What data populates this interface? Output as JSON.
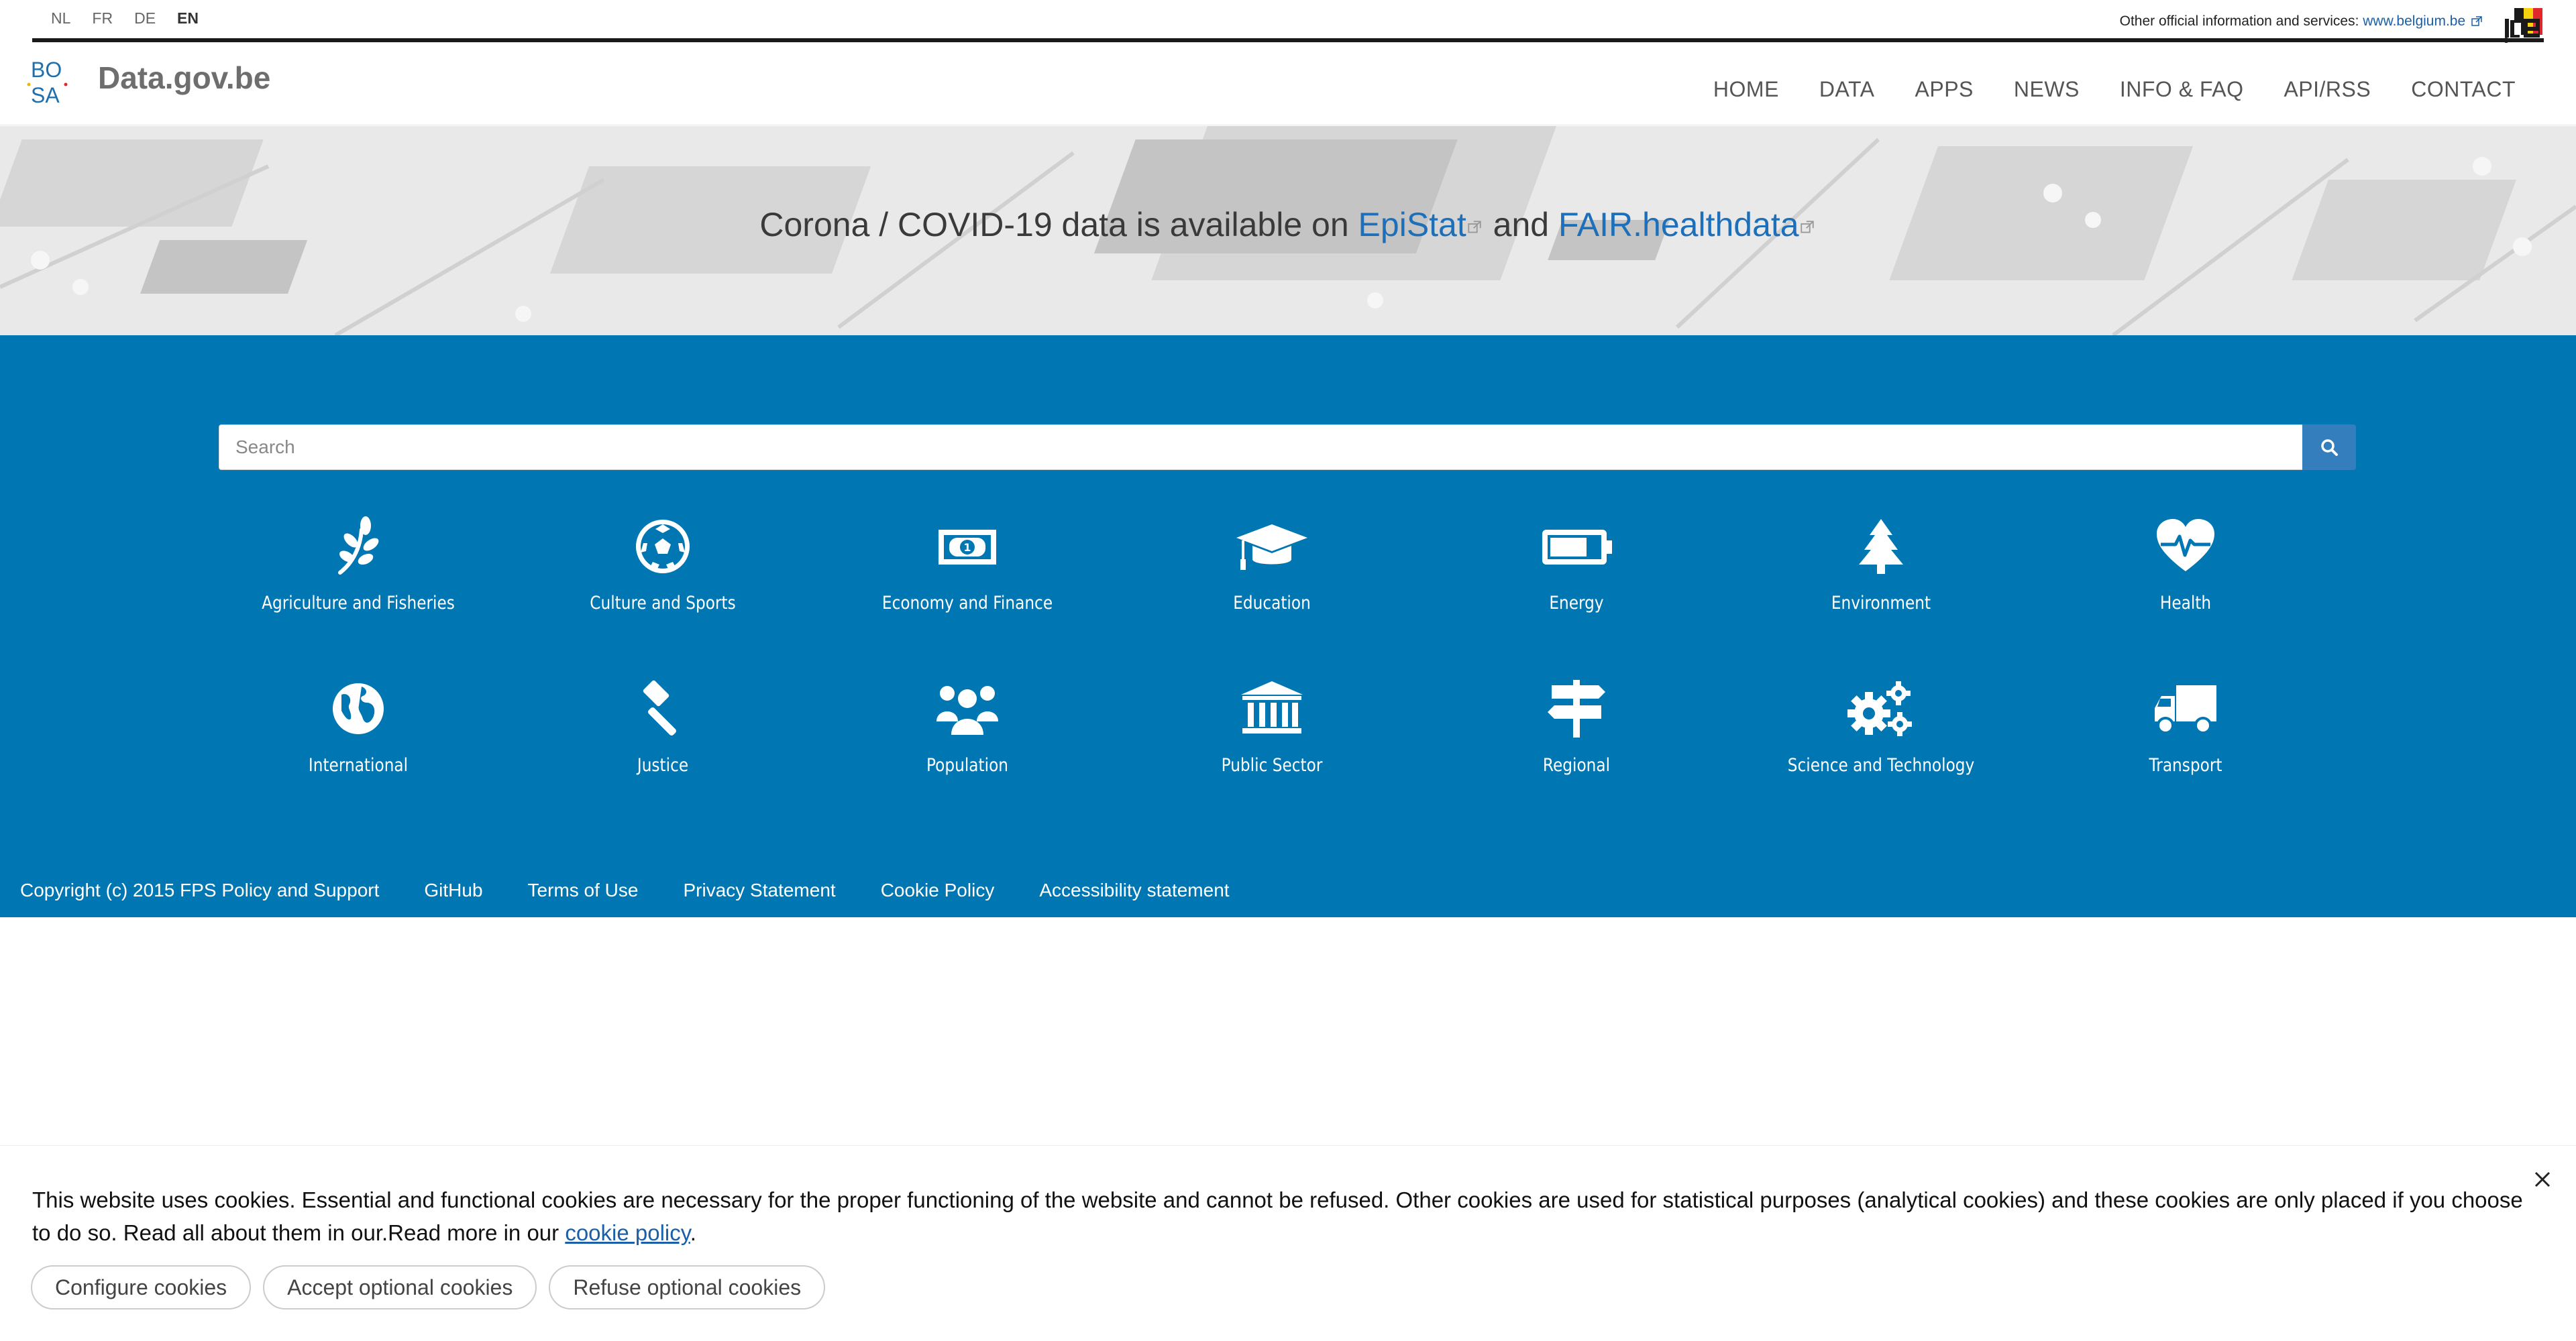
{
  "languages": {
    "nl": "NL",
    "fr": "FR",
    "de": "DE",
    "en": "EN",
    "active": "EN"
  },
  "official": {
    "text": "Other official information and services:",
    "link": "www.belgium.be"
  },
  "header": {
    "site_title": "Data.gov.be",
    "logo_text": [
      "BO",
      "SA"
    ],
    "nav": [
      "HOME",
      "DATA",
      "APPS",
      "NEWS",
      "INFO & FAQ",
      "API/RSS",
      "CONTACT"
    ]
  },
  "hero": {
    "prefix": "Corona / COVID-19 data is available on",
    "link1": "EpiStat",
    "middle": "and",
    "link2": "FAIR.healthdata"
  },
  "search": {
    "placeholder": "Search",
    "button_icon": "search-icon"
  },
  "categories": [
    {
      "label": "Agriculture and Fisheries",
      "icon": "leaf-icon"
    },
    {
      "label": "Culture and Sports",
      "icon": "soccer-ball-icon"
    },
    {
      "label": "Economy and Finance",
      "icon": "banknote-icon"
    },
    {
      "label": "Education",
      "icon": "graduation-cap-icon"
    },
    {
      "label": "Energy",
      "icon": "battery-icon"
    },
    {
      "label": "Environment",
      "icon": "tree-icon"
    },
    {
      "label": "Health",
      "icon": "heartbeat-icon"
    },
    {
      "label": "International",
      "icon": "globe-icon"
    },
    {
      "label": "Justice",
      "icon": "gavel-icon"
    },
    {
      "label": "Population",
      "icon": "people-icon"
    },
    {
      "label": "Public Sector",
      "icon": "institution-icon"
    },
    {
      "label": "Regional",
      "icon": "signpost-icon"
    },
    {
      "label": "Science and Technology",
      "icon": "gears-icon"
    },
    {
      "label": "Transport",
      "icon": "truck-icon"
    }
  ],
  "footer": {
    "copyright": "Copyright (c) 2015 FPS Policy and Support",
    "links": [
      "GitHub",
      "Terms of Use",
      "Privacy Statement",
      "Cookie Policy",
      "Accessibility statement"
    ]
  },
  "cookie": {
    "text": "This website uses cookies. Essential and functional cookies are necessary for the proper functioning of the website and cannot be refused. Other cookies are used for statistical purposes (analytical cookies) and these cookies are only placed if you choose to do so. Read all about them in our.Read more in our",
    "link": "cookie policy",
    "after": ".",
    "buttons": [
      "Configure cookies",
      "Accept optional cookies",
      "Refuse optional cookies"
    ]
  },
  "colors": {
    "blue_band": "#0076b2",
    "link": "#1c6fb8",
    "search_button": "#357ebd"
  }
}
